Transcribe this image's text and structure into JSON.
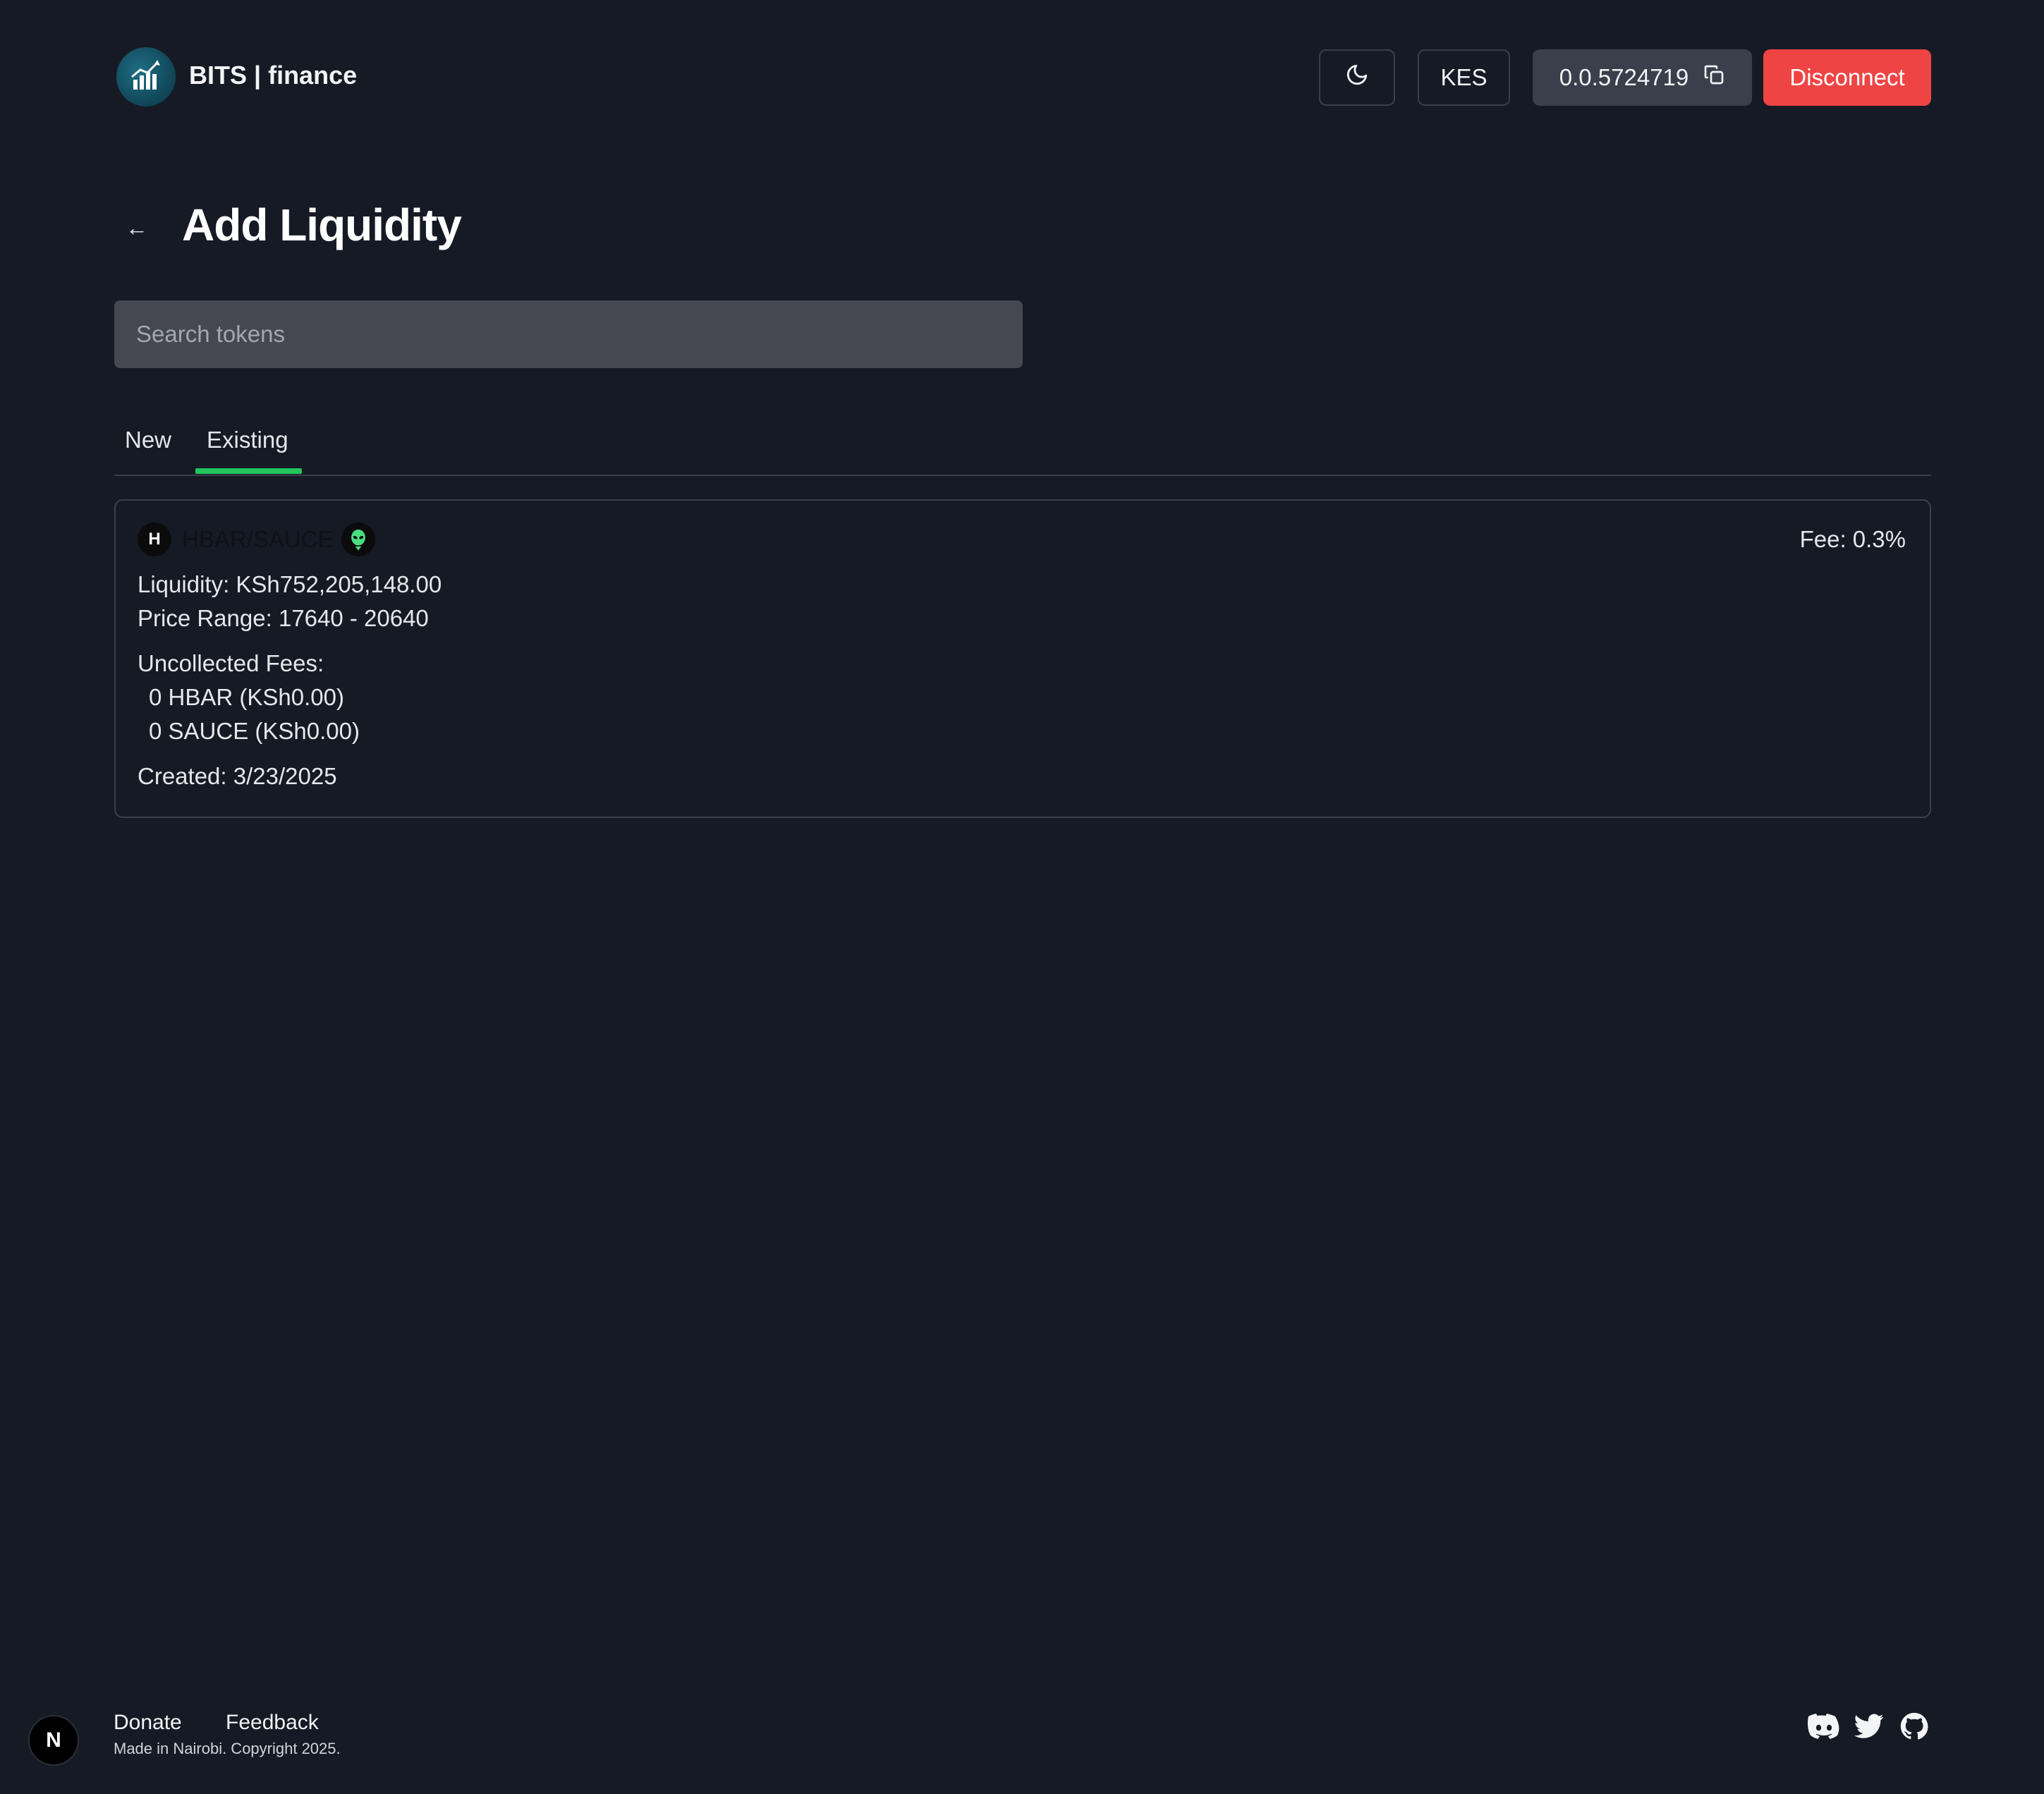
{
  "header": {
    "brand": "BITS | finance",
    "currency": "KES",
    "account_id": "0.0.5724719",
    "disconnect_label": "Disconnect",
    "icons": [
      "logo-chart-icon",
      "moon-icon",
      "copy-icon"
    ]
  },
  "page": {
    "back_arrow": "←",
    "title": "Add Liquidity"
  },
  "search": {
    "placeholder": "Search tokens",
    "value": ""
  },
  "tabs": {
    "items": [
      {
        "label": "New",
        "active": false
      },
      {
        "label": "Existing",
        "active": true
      }
    ],
    "active_color": "#22c55e"
  },
  "position": {
    "token_a_symbol": "H",
    "pair": "HBAR/SAUCE",
    "fee": "Fee: 0.3%",
    "liquidity": "Liquidity: KSh752,205,148.00",
    "price_range": "Price Range: 17640 - 20640",
    "uncollected_label": "Uncollected Fees:",
    "uncollected": [
      "0 HBAR (KSh0.00)",
      "0 SAUCE (KSh0.00)"
    ],
    "created": "Created: 3/23/2025"
  },
  "footer": {
    "next_logo": "N",
    "donate": "Donate",
    "feedback": "Feedback",
    "copyright": "Made in Nairobi. Copyright 2025.",
    "social_icons": [
      "discord-icon",
      "twitter-icon",
      "github-icon"
    ]
  },
  "colors": {
    "background": "#161a25",
    "disconnect": "#ef4444",
    "account_button": "#3a3f4b",
    "search_bg": "#454851",
    "accent_green": "#22c55e"
  }
}
